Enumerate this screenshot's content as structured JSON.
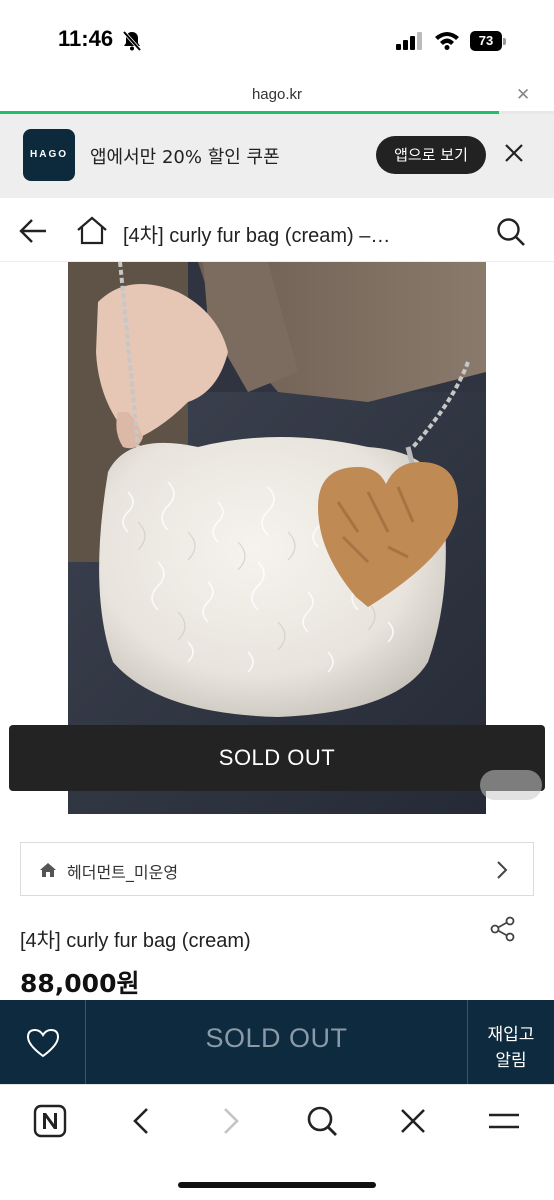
{
  "status_bar": {
    "time": "11:46",
    "battery": "73",
    "icons": [
      "bell-off-icon",
      "signal-icon",
      "wifi-icon",
      "battery-icon"
    ]
  },
  "browser": {
    "url": "hago.kr",
    "load_progress": 0.9
  },
  "app_banner": {
    "logo_text": "HAGO",
    "message": "앱에서만 20% 할인 쿠폰",
    "open_app_label": "앱으로 보기"
  },
  "header": {
    "title": "[4차] curly fur bag (cream) –…"
  },
  "product": {
    "image_alt": "white curly fur bag with tan heart charm",
    "sold_out_overlay": "SOLD OUT",
    "seller": "헤더먼트_미운영",
    "name": "[4차] curly fur bag (cream)",
    "price": "88,000원"
  },
  "action_bar": {
    "sold_out_label": "SOLD OUT",
    "restock_line1": "재입고",
    "restock_line2": "알림"
  },
  "colors": {
    "brand_navy": "#0e2a3e",
    "progress_green": "#1ec06b",
    "banner_bg": "#eeeeee"
  }
}
